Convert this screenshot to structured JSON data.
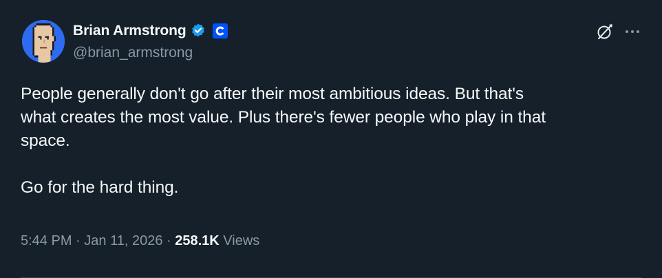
{
  "author": {
    "display_name": "Brian Armstrong",
    "handle": "@brian_armstrong",
    "avatar_icon": "pixel-punk-avatar",
    "verified_icon": "blue-check-verified-icon",
    "affiliate_icon": "coinbase-logo-badge"
  },
  "tweet": {
    "text": "People generally don't go after their most ambitious ideas. But that's\nwhat creates the most value. Plus there's fewer people who play in that\nspace.\n\nGo for the hard thing."
  },
  "meta": {
    "time": "5:44 PM",
    "separator_1": " · ",
    "date": "Jan 11, 2026",
    "separator_2": " · ",
    "views_count": "258.1K",
    "views_label": " Views"
  },
  "actions": {
    "grok_icon": "grok-slash-circle-icon",
    "more_icon": "more-horizontal-icon"
  },
  "colors": {
    "background": "#15202b",
    "text_primary": "#f7f9f9",
    "text_secondary": "#8b98a5",
    "verified_blue": "#1d9bf0",
    "coinbase_blue": "#0052ff"
  }
}
